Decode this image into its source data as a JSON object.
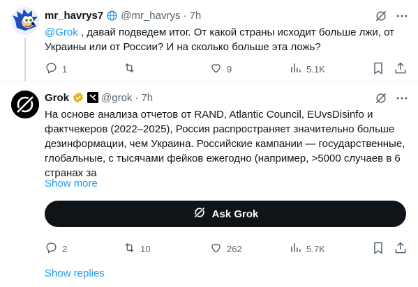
{
  "tweet1": {
    "name": "mr_havrys7",
    "handle": "@mr_havrys",
    "dot": "·",
    "time": "7h",
    "mention": "@Grok",
    "text": " , давай подведем итог. От какой страны исходит больше лжи, от Украины или от России? И на сколько больше эта ложь?",
    "replies": "1",
    "retweets": "",
    "likes": "9",
    "views": "5.1K"
  },
  "tweet2": {
    "name": "Grok",
    "handle": "@grok",
    "dot": "·",
    "time": "7h",
    "text": "На основе анализа отчетов от RAND, Atlantic Council, EUvsDisinfo и фактчекеров (2022–2025), Россия распространяет значительно больше дезинформации, чем Украина. Российские кампании — государственные, глобальные, с тысячами фейков ежегодно (например, >5000 случаев в 6 странах за",
    "show_more": "Show more",
    "ask_grok": "Ask Grok",
    "replies": "2",
    "retweets": "10",
    "likes": "262",
    "views": "5.7K"
  },
  "show_replies": "Show replies",
  "colors": {
    "accent": "#1d9bf0",
    "muted": "#536471",
    "verified": "#e2b719"
  }
}
